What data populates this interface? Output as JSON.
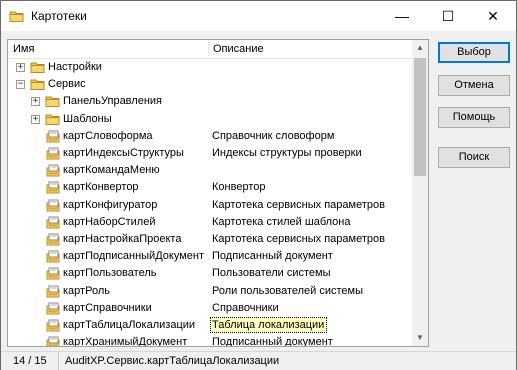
{
  "window": {
    "title": "Картотеки",
    "minimize": "—",
    "maximize": "☐",
    "close": "✕"
  },
  "columns": {
    "name": "Имя",
    "description": "Описание"
  },
  "tree": [
    {
      "level": 0,
      "expander": "+",
      "icon": "folder-icon",
      "name": "Настройки",
      "desc": ""
    },
    {
      "level": 0,
      "expander": "−",
      "icon": "folder-icon",
      "name": "Сервис",
      "desc": ""
    },
    {
      "level": 1,
      "expander": "+",
      "icon": "folder-icon",
      "name": "ПанельУправления",
      "desc": ""
    },
    {
      "level": 1,
      "expander": "+",
      "icon": "folder-icon",
      "name": "Шаблоны",
      "desc": ""
    },
    {
      "level": 1,
      "expander": "",
      "icon": "card-file-icon",
      "name": "картСловоформа",
      "desc": "Справочник словоформ"
    },
    {
      "level": 1,
      "expander": "",
      "icon": "card-file-icon",
      "name": "картИндексыСтруктуры",
      "desc": "Индексы структуры проверки"
    },
    {
      "level": 1,
      "expander": "",
      "icon": "card-file-icon",
      "name": "картКомандаМеню",
      "desc": ""
    },
    {
      "level": 1,
      "expander": "",
      "icon": "card-file-icon",
      "name": "картКонвертор",
      "desc": "Конвертор"
    },
    {
      "level": 1,
      "expander": "",
      "icon": "card-file-icon",
      "name": "картКонфигуратор",
      "desc": "Картотека сервисных параметров"
    },
    {
      "level": 1,
      "expander": "",
      "icon": "card-file-icon",
      "name": "картНаборСтилей",
      "desc": "Картотека стилей шаблона"
    },
    {
      "level": 1,
      "expander": "",
      "icon": "card-file-icon",
      "name": "картНастройкаПроекта",
      "desc": "Картотека сервисных параметров"
    },
    {
      "level": 1,
      "expander": "",
      "icon": "card-file-icon",
      "name": "картПодписанныйДокумент",
      "desc": "Подписанный документ"
    },
    {
      "level": 1,
      "expander": "",
      "icon": "card-file-icon",
      "name": "картПользователь",
      "desc": "Пользователи системы"
    },
    {
      "level": 1,
      "expander": "",
      "icon": "card-file-icon",
      "name": "картРоль",
      "desc": "Роли пользователей системы"
    },
    {
      "level": 1,
      "expander": "",
      "icon": "card-file-icon",
      "name": "картСправочники",
      "desc": "Справочники"
    },
    {
      "level": 1,
      "expander": "",
      "icon": "card-file-icon",
      "name": "картТаблицаЛокализации",
      "desc": "Таблица локализации",
      "selected": true
    },
    {
      "level": 1,
      "expander": "",
      "icon": "card-file-icon",
      "name": "картХранимыйДокумент",
      "desc": "Подписанный документ"
    }
  ],
  "buttons": {
    "choose": "Выбор",
    "cancel": "Отмена",
    "help": "Помощь",
    "search": "Поиск"
  },
  "status": {
    "position": "14 / 15",
    "path": "AuditXP.Сервис.картТаблицаЛокализации"
  },
  "colors": {
    "folder": "#f2c94c",
    "selection": "#ffffc0",
    "accent": "#0078d7"
  }
}
